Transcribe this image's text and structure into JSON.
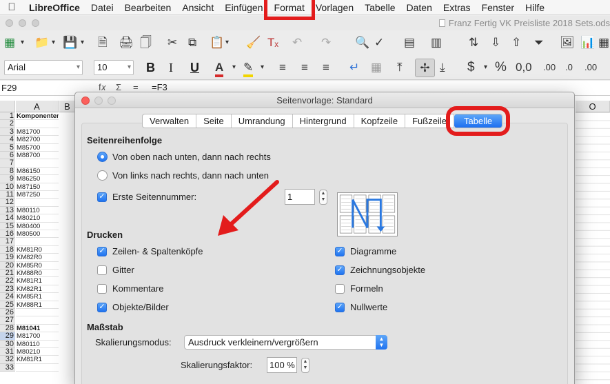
{
  "menubar": {
    "app": "LibreOffice",
    "items": [
      "Datei",
      "Bearbeiten",
      "Ansicht",
      "Einfügen",
      "Format",
      "Vorlagen",
      "Tabelle",
      "Daten",
      "Extras",
      "Fenster",
      "Hilfe"
    ],
    "highlighted": "Format"
  },
  "window": {
    "title": "Franz Fertig VK Preisliste 2018 Sets.ods"
  },
  "toolbar": {
    "font_name": "Arial",
    "font_size": "10",
    "bold_label": "B",
    "italic_label": "I",
    "underline_label": "U"
  },
  "formula_bar": {
    "cell_ref": "F29",
    "fx_symbol": "f𝑥",
    "sum_symbol": "Σ",
    "eq_symbol": "=",
    "content": "=F3"
  },
  "sheet": {
    "columns": [
      "A",
      "B",
      "O"
    ],
    "rows": [
      {
        "n": "1",
        "a": "Komponenten",
        "bold": true
      },
      {
        "n": "2",
        "a": ""
      },
      {
        "n": "3",
        "a": "M81700"
      },
      {
        "n": "4",
        "a": "M82700"
      },
      {
        "n": "5",
        "a": "M85700"
      },
      {
        "n": "6",
        "a": "M88700"
      },
      {
        "n": "7",
        "a": ""
      },
      {
        "n": "8",
        "a": "M86150"
      },
      {
        "n": "9",
        "a": "M86250"
      },
      {
        "n": "10",
        "a": "M87150"
      },
      {
        "n": "11",
        "a": "M87250"
      },
      {
        "n": "12",
        "a": ""
      },
      {
        "n": "13",
        "a": "M80110"
      },
      {
        "n": "14",
        "a": "M80210"
      },
      {
        "n": "15",
        "a": "M80400"
      },
      {
        "n": "16",
        "a": "M80500"
      },
      {
        "n": "17",
        "a": ""
      },
      {
        "n": "18",
        "a": "KM81R0"
      },
      {
        "n": "19",
        "a": "KM82R0"
      },
      {
        "n": "20",
        "a": "KM85R0"
      },
      {
        "n": "21",
        "a": "KM88R0"
      },
      {
        "n": "22",
        "a": "KM81R1"
      },
      {
        "n": "23",
        "a": "KM82R1"
      },
      {
        "n": "24",
        "a": "KM85R1"
      },
      {
        "n": "25",
        "a": "KM88R1"
      },
      {
        "n": "26",
        "a": ""
      },
      {
        "n": "27",
        "a": ""
      },
      {
        "n": "28",
        "a": "M81041",
        "bold": true
      },
      {
        "n": "29",
        "a": "M81700",
        "selected": true
      },
      {
        "n": "30",
        "a": "M80110"
      },
      {
        "n": "31",
        "a": "M80210"
      },
      {
        "n": "32",
        "a": "KM81R1"
      },
      {
        "n": "33",
        "a": ""
      }
    ]
  },
  "dialog": {
    "title": "Seitenvorlage: Standard",
    "tabs": [
      "Verwalten",
      "Seite",
      "Umrandung",
      "Hintergrund",
      "Kopfzeile",
      "Fußzeile",
      "Tabelle"
    ],
    "active_tab": "Tabelle",
    "page_order": {
      "heading": "Seitenreihenfolge",
      "option_top_down": "Von oben nach unten, dann nach rechts",
      "option_left_right": "Von links nach rechts, dann nach unten",
      "selected": "top_down",
      "first_page_label": "Erste Seitennummer:",
      "first_page_checked": true,
      "first_page_value": "1"
    },
    "print": {
      "heading": "Drucken",
      "left": [
        {
          "label": "Zeilen- & Spaltenköpfe",
          "checked": true
        },
        {
          "label": "Gitter",
          "checked": false
        },
        {
          "label": "Kommentare",
          "checked": false
        },
        {
          "label": "Objekte/Bilder",
          "checked": true
        }
      ],
      "right": [
        {
          "label": "Diagramme",
          "checked": true
        },
        {
          "label": "Zeichnungsobjekte",
          "checked": true
        },
        {
          "label": "Formeln",
          "checked": false
        },
        {
          "label": "Nullwerte",
          "checked": true
        }
      ]
    },
    "scale": {
      "heading": "Maßstab",
      "mode_label": "Skalierungsmodus:",
      "mode_value": "Ausdruck verkleinern/vergrößern",
      "factor_label": "Skalierungsfaktor:",
      "factor_value": "100 %"
    }
  },
  "colors": {
    "accent": "#1f73f0",
    "annotation": "#e31c1c"
  }
}
